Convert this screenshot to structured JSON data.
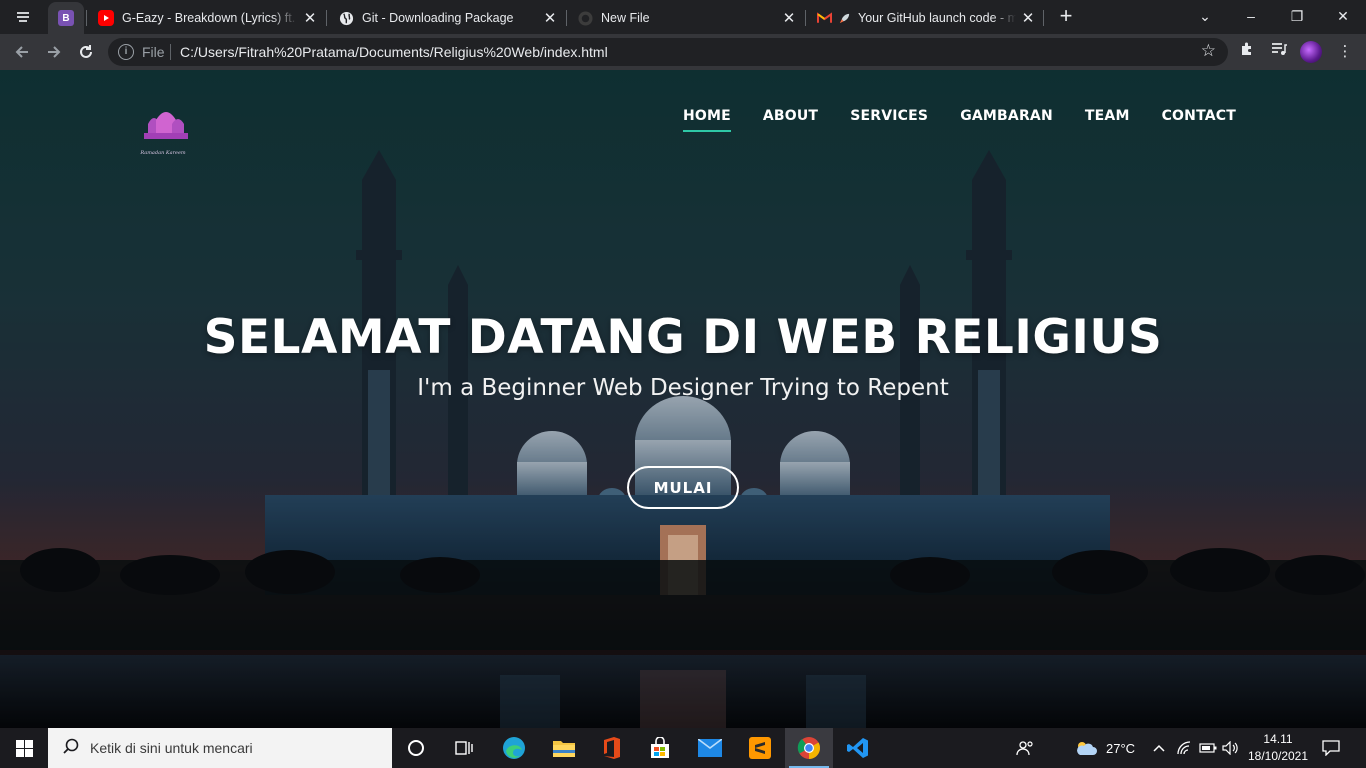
{
  "browser": {
    "tabs": [
      {
        "title": "G-Eazy - Breakdown (Lyrics) ft. Drake",
        "favicon": "youtube-icon"
      },
      {
        "title": "Git - Downloading Package",
        "favicon": "globe-icon"
      },
      {
        "title": "New File",
        "favicon": "github-icon"
      },
      {
        "title": "Your GitHub launch code - m",
        "favicon": "gmail-icon"
      }
    ],
    "pinned_tab_letter": "B",
    "address": {
      "scheme": "File",
      "url": "C:/Users/Fitrah%20Pratama/Documents/Religius%20Web/index.html"
    }
  },
  "site": {
    "logo_caption": "Ramadan Kareem",
    "nav": [
      "HOME",
      "ABOUT",
      "SERVICES",
      "GAMBARAN",
      "TEAM",
      "CONTACT"
    ],
    "active_nav": "HOME",
    "hero": {
      "title": "SELAMAT DATANG DI WEB RELIGIUS",
      "subtitle": "I'm a Beginner Web Designer Trying to Repent",
      "button": "MULAI"
    },
    "accent_color": "#2ec8a6"
  },
  "taskbar": {
    "search_placeholder": "Ketik di sini untuk mencari",
    "weather": "27°C",
    "time": "14.11",
    "date": "18/10/2021"
  }
}
